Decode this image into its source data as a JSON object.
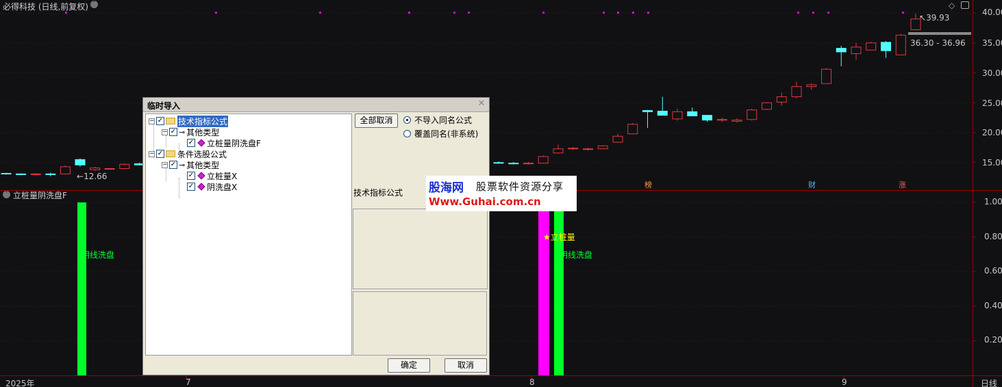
{
  "chart_title": "必得科技 (日线,前复权)",
  "indicator_title": "立桩量阴洗盘F",
  "price_axis": [
    "40.00",
    "35.00",
    "30.00",
    "25.00",
    "20.00",
    "15.00"
  ],
  "ind_axis": [
    "1.00",
    "0.80",
    "0.60",
    "0.40",
    "0.20"
  ],
  "time_axis": {
    "year": "2025年",
    "months": [
      "7",
      "8",
      "9"
    ],
    "period": "日线"
  },
  "price_labels": {
    "low": "12.66",
    "high": "39.93",
    "range": "36.30 - 36.96"
  },
  "event_markers": [
    "榜",
    "财",
    "涨"
  ],
  "indicator_labels": {
    "left_yin": "阴线洗盘",
    "stake": "★立桩量",
    "right_yin": "阴线洗盘"
  },
  "colors": {
    "up": "#e0383e",
    "down": "#54ffff",
    "green_bar": "#00ff2a",
    "magenta_bar": "#ff00ff",
    "stake_text": "#ffff00"
  },
  "chart_data": {
    "type": "candlestick",
    "ylim": [
      11,
      41
    ],
    "candles": [
      [
        13.2,
        13.3,
        13.0,
        13.1
      ],
      [
        13.1,
        13.2,
        12.9,
        13.0
      ],
      [
        13.0,
        13.2,
        12.9,
        13.1
      ],
      [
        13.1,
        13.3,
        12.7,
        13.0
      ],
      [
        13.1,
        14.5,
        13.0,
        14.3
      ],
      [
        15.5,
        15.7,
        14.3,
        14.6
      ],
      [
        13.8,
        14.3,
        13.6,
        14.1
      ],
      [
        13.9,
        14.1,
        13.8,
        14.0
      ],
      [
        14.0,
        14.9,
        13.9,
        14.7
      ],
      [
        14.8,
        15.0,
        14.5,
        14.6
      ],
      [
        15.0,
        15.2,
        14.8,
        14.9
      ],
      [
        14.9,
        15.1,
        14.7,
        14.8
      ],
      [
        14.8,
        15.1,
        14.7,
        14.9
      ],
      [
        14.9,
        16.2,
        14.8,
        16.0
      ],
      [
        16.6,
        18.0,
        16.5,
        17.3
      ],
      [
        17.3,
        17.6,
        17.1,
        17.4
      ],
      [
        17.2,
        17.5,
        17.0,
        17.3
      ],
      [
        17.3,
        17.9,
        17.2,
        17.8
      ],
      [
        18.4,
        19.8,
        18.3,
        19.4
      ],
      [
        19.8,
        21.6,
        19.7,
        21.4
      ],
      [
        23.7,
        23.8,
        20.8,
        23.5
      ],
      [
        23.6,
        26.0,
        22.9,
        22.9
      ],
      [
        22.3,
        24.0,
        22.0,
        23.5
      ],
      [
        23.5,
        24.2,
        22.8,
        22.8
      ],
      [
        22.9,
        22.9,
        21.8,
        22.1
      ],
      [
        22.2,
        22.5,
        21.8,
        22.2
      ],
      [
        21.9,
        22.4,
        21.7,
        22.1
      ],
      [
        22.2,
        24.0,
        22.0,
        23.8
      ],
      [
        23.9,
        25.0,
        23.8,
        25.0
      ],
      [
        25.1,
        26.7,
        24.5,
        26.0
      ],
      [
        26.0,
        28.5,
        25.7,
        27.7
      ],
      [
        27.7,
        28.3,
        27.2,
        28.0
      ],
      [
        28.2,
        30.8,
        28.2,
        30.6
      ],
      [
        34.1,
        34.5,
        31.1,
        33.5
      ],
      [
        33.2,
        35.0,
        32.2,
        34.3
      ],
      [
        33.8,
        35.2,
        33.8,
        35.0
      ],
      [
        35.1,
        35.3,
        32.5,
        33.7
      ],
      [
        33.0,
        36.5,
        33.0,
        36.3
      ],
      [
        37.2,
        39.9,
        37.1,
        39.0
      ]
    ],
    "indicator_bars": [
      {
        "type": "阴线洗盘",
        "value": 1.0
      },
      {
        "type": "立桩量",
        "value": 1.0
      },
      {
        "type": "阴线洗盘",
        "value": 1.0
      }
    ]
  },
  "dialog": {
    "title": "临时导入",
    "tree": [
      {
        "label": "技术指标公式",
        "kind": "folder",
        "checked": true
      },
      {
        "label": "其他类型",
        "kind": "key",
        "checked": true
      },
      {
        "label": "立桩量阴洗盘F",
        "kind": "gem",
        "checked": true
      },
      {
        "label": "条件选股公式",
        "kind": "folder",
        "checked": true
      },
      {
        "label": "其他类型",
        "kind": "key",
        "checked": true
      },
      {
        "label": "立桩量X",
        "kind": "gem",
        "checked": true
      },
      {
        "label": "阴洗盘X",
        "kind": "gem",
        "checked": true
      }
    ],
    "cancel_all": "全部取消",
    "radio_1": "不导入同名公式",
    "radio_2": "覆盖同名(非系统)",
    "group_label": "技术指标公式",
    "ok": "确定",
    "cancel": "取消"
  },
  "watermark": {
    "brand": "股海网",
    "slogan": "股票软件资源分享",
    "url": "Www.Guhai.com.cn"
  }
}
